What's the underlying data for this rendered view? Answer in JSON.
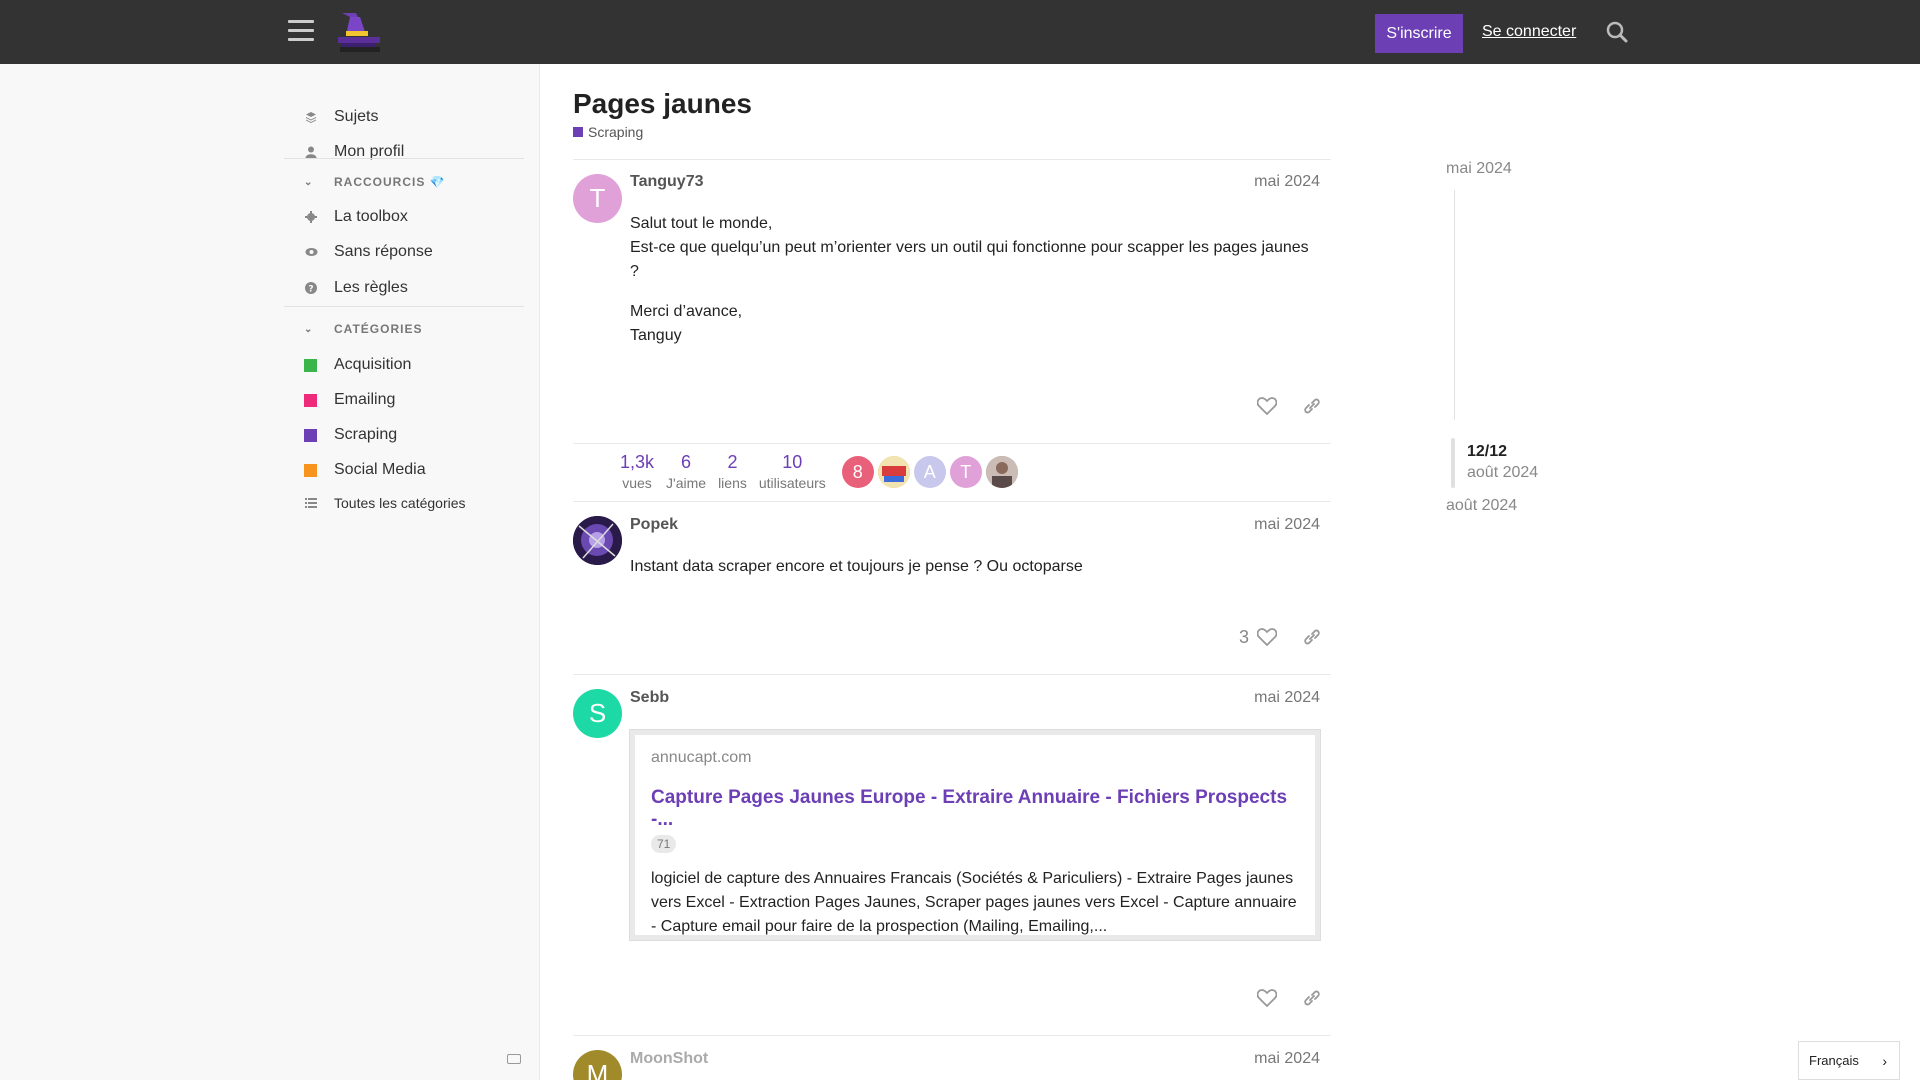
{
  "header": {
    "signup_label": "S'inscrire",
    "login_label": "Se connecter"
  },
  "sidebar": {
    "nav": [
      {
        "label": "Sujets",
        "icon": "layers-icon"
      },
      {
        "label": "Mon profil",
        "icon": "user-icon"
      }
    ],
    "shortcuts_heading": "RACCOURCIS 💎",
    "shortcuts": [
      {
        "label": "La toolbox",
        "icon": "gear-icon"
      },
      {
        "label": "Sans réponse",
        "icon": "eye-icon"
      },
      {
        "label": "Les règles",
        "icon": "question-icon"
      }
    ],
    "categories_heading": "CATÉGORIES",
    "categories": [
      {
        "label": "Acquisition",
        "color": "#3ab54a"
      },
      {
        "label": "Emailing",
        "color": "#ee2a7b"
      },
      {
        "label": "Scraping",
        "color": "#6c3fb5"
      },
      {
        "label": "Social Media",
        "color": "#f7941d"
      }
    ],
    "all_categories_label": "Toutes les catégories"
  },
  "topic": {
    "title": "Pages jaunes",
    "category": "Scraping"
  },
  "posts": [
    {
      "username": "Tanguy73",
      "avatar_letter": "T",
      "avatar_color": "#e0a0d8",
      "date": "mai 2024",
      "paragraphs": [
        "Salut tout le monde,",
        "Est-ce que quelqu’un peut m’orienter vers un outil qui fonctionne pour scapper les pages jaunes ?",
        "Merci d’avance,",
        "Tanguy"
      ]
    },
    {
      "username": "Popek",
      "date": "mai 2024",
      "text": "Instant data scraper encore et toujours je pense ? Ou octoparse",
      "likes": "3"
    },
    {
      "username": "Sebb",
      "avatar_letter": "S",
      "avatar_color": "#1dd9a5",
      "date": "mai 2024",
      "onebox": {
        "domain": "annucapt.com",
        "title": "Capture Pages Jaunes Europe - Extraire Annuaire - Fichiers Prospects -...",
        "clicks": "71",
        "description": "logiciel de capture des Annuaires Francais (Sociétés & Pariculiers) - Extraire Pages jaunes vers Excel - Extraction Pages Jaunes, Scraper pages jaunes vers Excel - Capture annuaire - Capture email pour faire de la prospection (Mailing, Emailing,..."
      }
    },
    {
      "username": "MoonShot",
      "avatar_letter": "M",
      "avatar_color": "#a08a2a",
      "date": "mai 2024"
    }
  ],
  "stats": [
    {
      "num": "1,3k",
      "label": "vues"
    },
    {
      "num": "6",
      "label": "J'aime"
    },
    {
      "num": "2",
      "label": "liens"
    },
    {
      "num": "10",
      "label": "utilisateurs"
    }
  ],
  "participants": [
    {
      "letter": "8",
      "color": "#e8607a"
    },
    {
      "letter": "",
      "color": "#d8c070"
    },
    {
      "letter": "A",
      "color": "#c8c8ec"
    },
    {
      "letter": "T",
      "color": "#e0a0d8"
    },
    {
      "letter": "",
      "color": "#9a8a8a"
    }
  ],
  "timeline": {
    "top_date": "mai 2024",
    "position": "12/12",
    "current_date": "août 2024",
    "bottom_date": "août 2024"
  },
  "language": {
    "selected": "Français"
  }
}
